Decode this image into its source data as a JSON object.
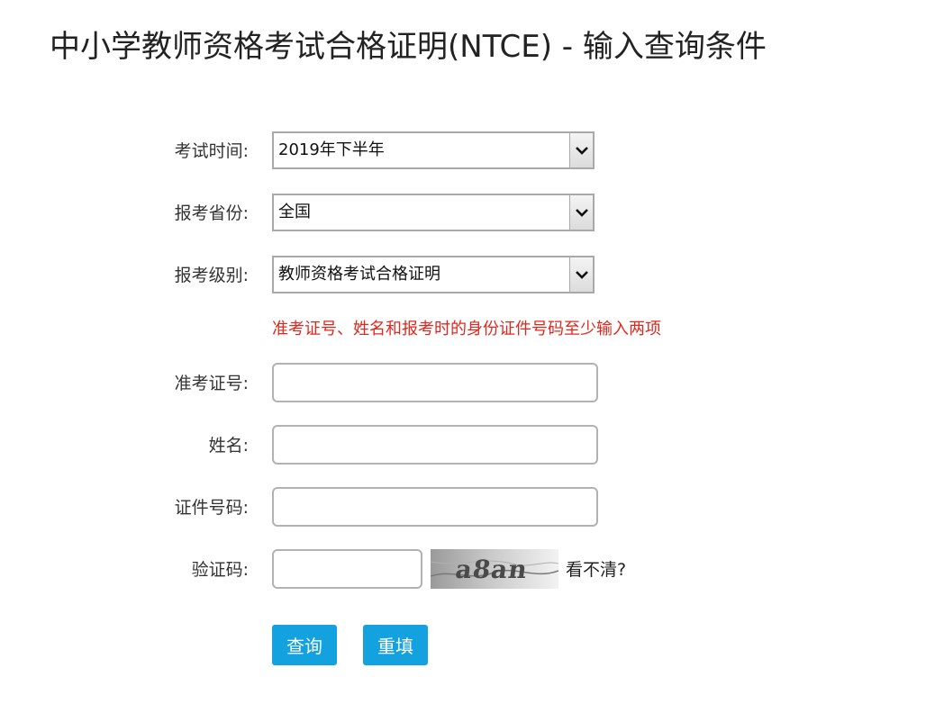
{
  "page": {
    "title": "中小学教师资格考试合格证明(NTCE) - 输入查询条件"
  },
  "form": {
    "exam_time": {
      "label": "考试时间:",
      "selected": "2019年下半年"
    },
    "province": {
      "label": "报考省份:",
      "selected": "全国"
    },
    "level": {
      "label": "报考级别:",
      "selected": "教师资格考试合格证明"
    },
    "notice": "准考证号、姓名和报考时的身份证件号码至少输入两项",
    "admission_number": {
      "label": "准考证号:",
      "value": ""
    },
    "name": {
      "label": "姓名:",
      "value": ""
    },
    "id_number": {
      "label": "证件号码:",
      "value": ""
    },
    "captcha": {
      "label": "验证码:",
      "value": "",
      "image_text": "a8an",
      "refresh_text": "看不清?"
    },
    "buttons": {
      "query": "查询",
      "reset": "重填"
    }
  },
  "colors": {
    "button": "#13a2df",
    "notice": "#e0281e",
    "input_border": "#b2b2b2"
  },
  "icons": {
    "select_arrow": "chevron-down-icon"
  }
}
